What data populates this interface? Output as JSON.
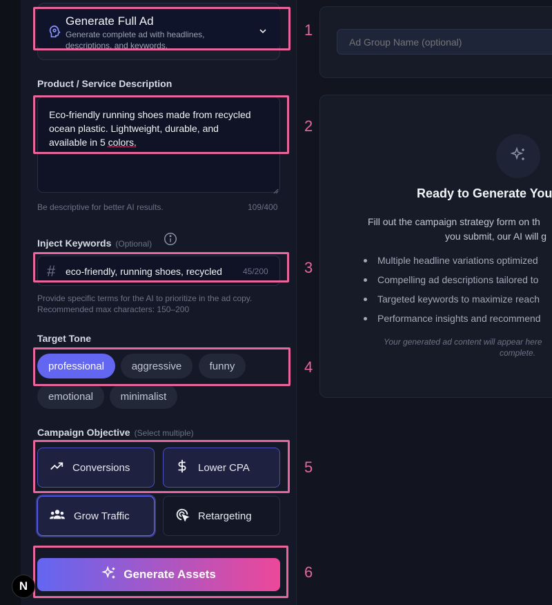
{
  "mode": {
    "title": "Generate Full Ad",
    "description_line1": "Generate complete ad with headlines,",
    "description_line2": "descriptions, and keywords."
  },
  "product": {
    "label": "Product / Service Description",
    "value_line1": "Eco-friendly running shoes made from recycled",
    "value_line2": "ocean plastic. Lightweight, durable, and",
    "value_line3_a": "available in 5 ",
    "value_line3_b": "colors.",
    "hint": "Be descriptive for better AI results.",
    "count": "109/400"
  },
  "keywords": {
    "label": "Inject Keywords",
    "optional": "(Optional)",
    "value": "eco-friendly, running shoes, recycled",
    "count": "45/200",
    "hint_line1": "Provide specific terms for the AI to prioritize in the ad copy.",
    "hint_line2": "Recommended max characters: 150–200"
  },
  "tone": {
    "label": "Target Tone",
    "options": [
      "professional",
      "aggressive",
      "funny",
      "emotional",
      "minimalist"
    ],
    "selected": "professional"
  },
  "objective": {
    "label": "Campaign Objective",
    "note": "(Select multiple)",
    "options": [
      "Conversions",
      "Lower CPA",
      "Grow Traffic",
      "Retargeting"
    ]
  },
  "generate_button": "Generate Assets",
  "ad_group": {
    "placeholder": "Ad Group Name (optional)"
  },
  "empty_state": {
    "title": "Ready to Generate You",
    "desc_line1": "Fill out the campaign strategy form on th",
    "desc_line2": "you submit, our AI will g",
    "bullets": [
      "Multiple headline variations optimized",
      "Compelling ad descriptions tailored to",
      "Targeted keywords to maximize reach",
      "Performance insights and recommend"
    ],
    "note_line1": "Your generated ad content will appear here",
    "note_line2": "complete."
  },
  "annotations": [
    "1",
    "2",
    "3",
    "4",
    "5",
    "6"
  ],
  "devtools_badge": "N",
  "colors": {
    "accent": "#6366f1",
    "highlight": "#e8669b",
    "gradient_start": "#6366f1",
    "gradient_end": "#ec4899"
  },
  "icons": {
    "mode": "ai-head-icon",
    "chevron": "chevron-down-icon",
    "hash": "hash-icon",
    "info": "info-icon",
    "conversions": "trending-up-icon",
    "lower_cpa": "dollar-icon",
    "grow_traffic": "users-icon",
    "retargeting": "target-cursor-icon",
    "generate": "sparkles-icon",
    "empty_state": "sparkles-icon"
  }
}
